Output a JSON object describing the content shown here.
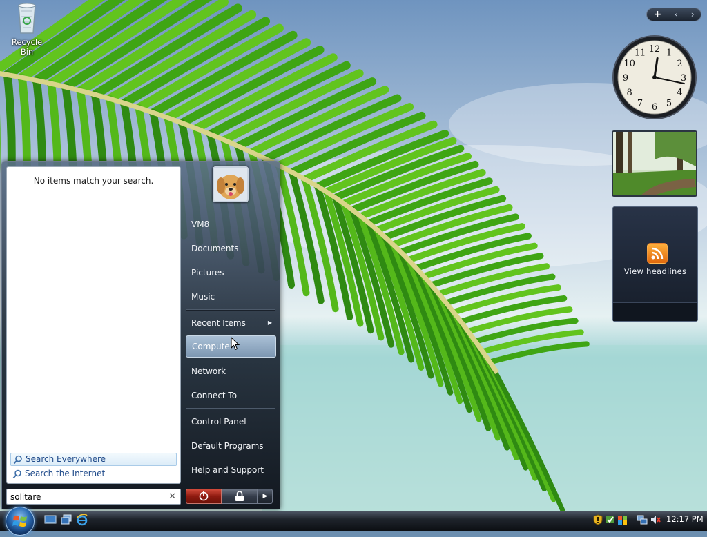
{
  "desktop": {
    "recycle_bin_label": "Recycle Bin"
  },
  "sidebar": {
    "controls": {
      "add": "+",
      "prev": "‹",
      "next": "›"
    },
    "clock": {
      "hour": 12,
      "minute": 17
    },
    "clock_numerals": [
      "12",
      "1",
      "2",
      "3",
      "4",
      "5",
      "6",
      "7",
      "8",
      "9",
      "10",
      "11"
    ],
    "feeds_label": "View headlines"
  },
  "start_menu": {
    "no_results_text": "No items match your search.",
    "search_links": [
      "Search Everywhere",
      "Search the Internet"
    ],
    "search_value": "solitare",
    "search_clear": "✕",
    "right_items": [
      {
        "label": "VM8"
      },
      {
        "label": "Documents"
      },
      {
        "label": "Pictures"
      },
      {
        "label": "Music"
      },
      {
        "label": "Recent Items",
        "has_submenu": true
      },
      {
        "label": "Computer",
        "hovered": true
      },
      {
        "label": "Network"
      },
      {
        "label": "Connect To"
      },
      {
        "label": "Control Panel"
      },
      {
        "label": "Default Programs"
      },
      {
        "label": "Help and Support"
      }
    ]
  },
  "taskbar": {
    "quick_launch": [
      "show-desktop-icon",
      "switch-windows-icon",
      "internet-explorer-icon"
    ],
    "tray_icons": [
      "security-shield-icon",
      "network-icon",
      "volume-muted-icon"
    ],
    "time": "12:17 PM"
  },
  "colors": {
    "accent": "#7d97b2",
    "link": "#1f4a8a",
    "rss": "#f08a24"
  }
}
